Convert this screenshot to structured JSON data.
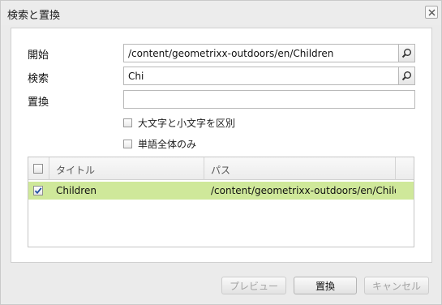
{
  "dialog": {
    "title": "検索と置換"
  },
  "form": {
    "start_label": "開始",
    "start_value": "/content/geometrixx-outdoors/en/Children",
    "search_label": "検索",
    "search_value": "Chi",
    "replace_label": "置換",
    "replace_value": "",
    "case_label": "大文字と小文字を区別",
    "case_checked": false,
    "whole_word_label": "単語全体のみ",
    "whole_word_checked": false
  },
  "grid": {
    "columns": [
      "タイトル",
      "パス"
    ],
    "rows": [
      {
        "title": "Children",
        "path": "/content/geometrixx-outdoors/en/Childr...",
        "checked": true,
        "selected": true
      }
    ]
  },
  "buttons": {
    "preview": "プレビュー",
    "replace": "置換",
    "cancel": "キャンセル"
  },
  "colors": {
    "selected_row": "#cfe89a",
    "dialog_bg": "#ebebeb"
  },
  "icons": {
    "close": "close-icon",
    "search": "search-icon",
    "check": "checkmark-icon"
  }
}
